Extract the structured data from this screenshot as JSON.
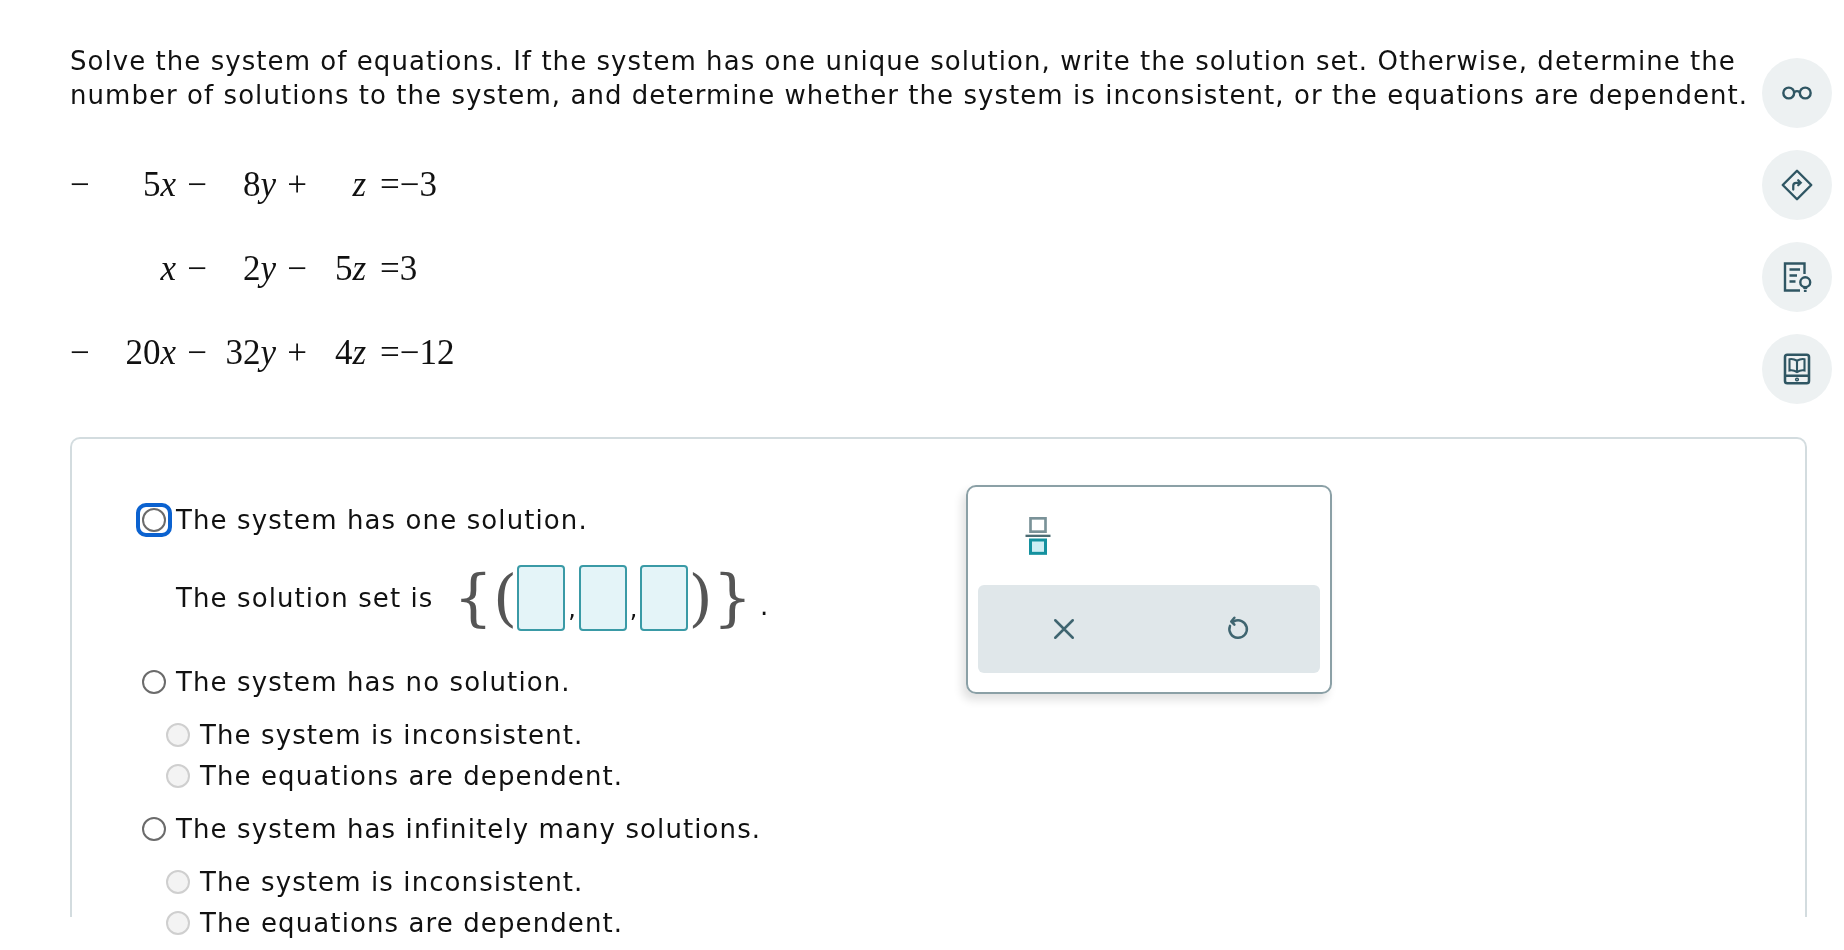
{
  "instructions": "Solve the system of equations. If the system has one unique solution, write the solution set. Otherwise, determine the number of solutions to the system, and determine whether the system is inconsistent, or the equations are dependent.",
  "equations": [
    {
      "sign": "−",
      "terms": [
        {
          "coef": "5",
          "var": "x",
          "op": "−"
        },
        {
          "coef": "8",
          "var": "y",
          "op": "+"
        },
        {
          "var": "z"
        }
      ],
      "rhs": "=−3"
    },
    {
      "terms": [
        {
          "var": "x",
          "op": "−"
        },
        {
          "coef": "2",
          "var": "y",
          "op": "−"
        },
        {
          "coef": "5",
          "var": "z"
        }
      ],
      "rhs": "=3"
    },
    {
      "sign": "−",
      "terms": [
        {
          "coef": "20",
          "var": "x",
          "op": "−"
        },
        {
          "coef": "32",
          "var": "y",
          "op": "+"
        },
        {
          "coef": "4",
          "var": "z"
        }
      ],
      "rhs": "=−12"
    }
  ],
  "side_tools": [
    {
      "kind": "glasses"
    },
    {
      "kind": "diamond-arrow"
    },
    {
      "kind": "document-bulb"
    },
    {
      "kind": "ebook"
    }
  ],
  "options": [
    {
      "label": "The system has one solution.",
      "selected": false,
      "focused": true,
      "solution_set": {
        "prefix": "The solution set is",
        "brace_open": "{",
        "paren_open": "(",
        "fields": [
          {
            "kind": "blank"
          },
          {
            "kind": "blank"
          },
          {
            "kind": "blank"
          }
        ],
        "separator": ",",
        "paren_close": ")",
        "brace_close": "}",
        "period": "."
      }
    },
    {
      "label": "The system has no solution.",
      "selected": false,
      "focused": false,
      "sub_options": [
        {
          "label": "The system is inconsistent.",
          "selected": false,
          "disabled": true
        },
        {
          "label": "The equations are dependent.",
          "selected": false,
          "disabled": true
        }
      ]
    },
    {
      "label": "The system has infinitely many solutions.",
      "selected": false,
      "focused": false,
      "sub_options": [
        {
          "label": "The system is inconsistent.",
          "selected": false,
          "disabled": true
        },
        {
          "label": "The equations are dependent.",
          "selected": false,
          "disabled": true
        }
      ]
    }
  ],
  "toolbox": {
    "tools": [
      {
        "kind": "fraction"
      }
    ],
    "actions": [
      {
        "kind": "clear"
      },
      {
        "kind": "undo"
      }
    ]
  }
}
